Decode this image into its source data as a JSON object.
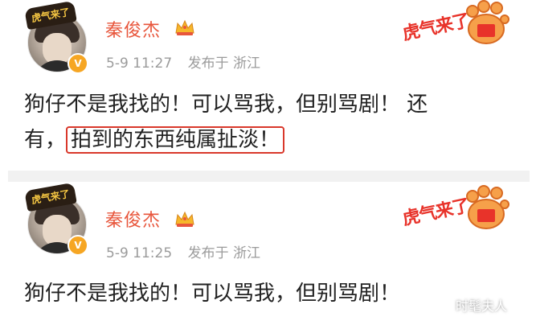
{
  "posts": [
    {
      "user": {
        "name": "秦俊杰",
        "verified_badge": "V"
      },
      "frame_text": "虎气来了",
      "meta": {
        "time": "5-9 11:27",
        "location": "发布于 浙江"
      },
      "content": {
        "line1": "狗仔不是我找的！可以骂我，但别骂剧！ 还",
        "line2_prefix": "有，",
        "line2_highlight": "拍到的东西纯属扯淡！"
      },
      "sticker_text": "虎气来了"
    },
    {
      "user": {
        "name": "秦俊杰",
        "verified_badge": "V"
      },
      "frame_text": "虎气来了",
      "meta": {
        "time": "5-9 11:25",
        "location": "发布于 浙江"
      },
      "content": {
        "line1": "狗仔不是我找的！可以骂我，但别骂剧！"
      },
      "sticker_text": "虎气来了"
    }
  ],
  "watermark": "时髦夫人",
  "colors": {
    "username": "#e8563c",
    "highlight_border": "#d9382b",
    "meta": "#9b9b9b"
  },
  "icons": [
    "crown-icon",
    "verified-badge-icon",
    "tiger-paw-sticker-icon"
  ]
}
